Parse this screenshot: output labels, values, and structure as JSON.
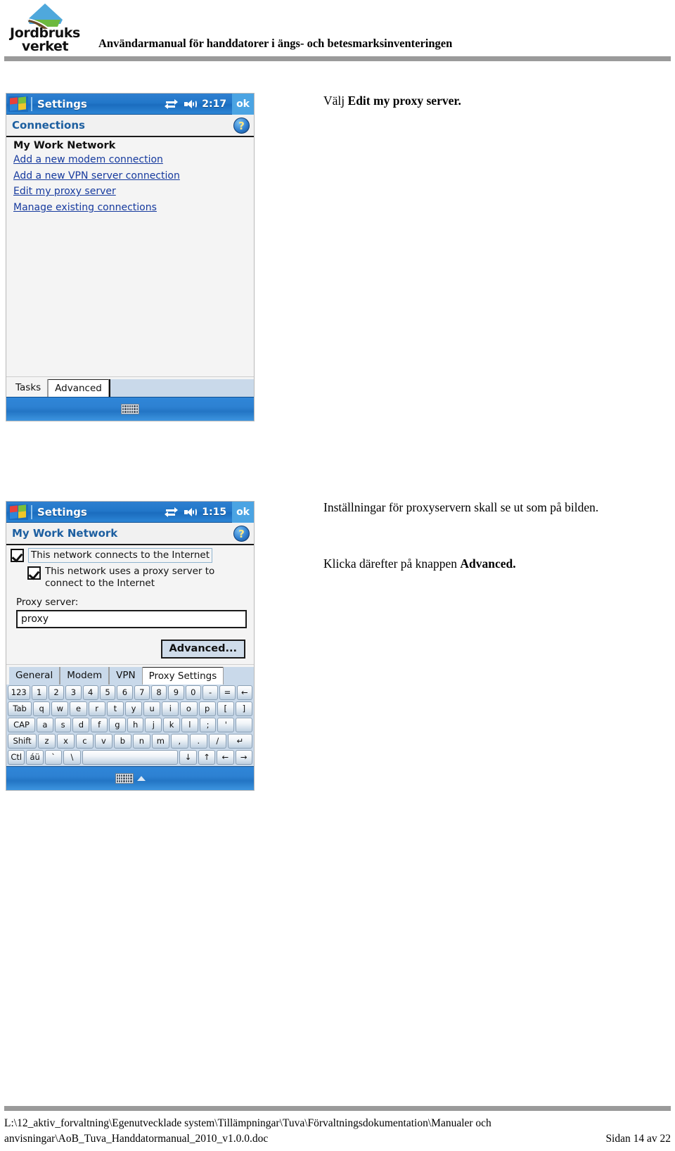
{
  "header": {
    "logo_line1": "Jordbruks",
    "logo_line2": "verket",
    "title": "Användarmanual för handdatorer i ängs- och betesmarksinventeringen"
  },
  "screen1": {
    "titlebar": {
      "app": "Settings",
      "clock": "2:17",
      "ok": "ok",
      "connectivity_icon": "connection-arrows-icon",
      "volume_icon": "speaker-icon",
      "start_icon": "windows-start-icon"
    },
    "page_title": "Connections",
    "help_label": "?",
    "group_title": "My Work Network",
    "links": [
      "Add a new modem connection",
      "Add a new VPN server connection",
      "Edit my proxy server",
      "Manage existing connections"
    ],
    "tabs": [
      {
        "label": "Tasks",
        "selected": false
      },
      {
        "label": "Advanced",
        "selected": true
      }
    ],
    "soft_keyboard_icon": "keyboard-icon"
  },
  "screen2": {
    "titlebar": {
      "app": "Settings",
      "clock": "1:15",
      "ok": "ok",
      "connectivity_icon": "connection-arrows-icon",
      "volume_icon": "speaker-icon",
      "start_icon": "windows-start-icon"
    },
    "page_title": "My Work Network",
    "help_label": "?",
    "checkbox1_label": "This network connects to the Internet",
    "checkbox1_checked": true,
    "checkbox2_label": "This network uses a proxy server to connect to the Internet",
    "checkbox2_checked": true,
    "proxy_field_label": "Proxy server:",
    "proxy_field_value": "proxy",
    "advanced_button": "Advanced...",
    "tabs": [
      {
        "label": "General",
        "selected": false
      },
      {
        "label": "Modem",
        "selected": false
      },
      {
        "label": "VPN",
        "selected": false
      },
      {
        "label": "Proxy Settings",
        "selected": true
      }
    ],
    "soft_keyboard_icon": "keyboard-icon",
    "caret_icon": "caret-up-icon",
    "keyboard_rows": [
      [
        "123",
        "1",
        "2",
        "3",
        "4",
        "5",
        "6",
        "7",
        "8",
        "9",
        "0",
        "-",
        "=",
        "←"
      ],
      [
        "Tab",
        "q",
        "w",
        "e",
        "r",
        "t",
        "y",
        "u",
        "i",
        "o",
        "p",
        "[",
        "]"
      ],
      [
        "CAP",
        "a",
        "s",
        "d",
        "f",
        "g",
        "h",
        "j",
        "k",
        "l",
        ";",
        "'"
      ],
      [
        "Shift",
        "z",
        "x",
        "c",
        "v",
        "b",
        "n",
        "m",
        ",",
        ".",
        "/",
        "↵"
      ],
      [
        "Ctl",
        "áü",
        "`",
        "\\",
        " ",
        "↓",
        "↑",
        "←",
        "→"
      ]
    ]
  },
  "notes": {
    "note1_prefix": "Välj ",
    "note1_bold": "Edit my proxy server.",
    "note2": "Inställningar för proxyservern skall se ut som på bilden.",
    "note3_prefix": "Klicka därefter på knappen ",
    "note3_bold": "Advanced."
  },
  "footer": {
    "path_line1": "L:\\12_aktiv_forvaltning\\Egenutvecklade system\\Tillämpningar\\Tuva\\Förvaltningsdokumentation\\Manualer och",
    "path_line2": "anvisningar\\AoB_Tuva_Handdatormanual_2010_v1.0.0.doc",
    "page_label": "Sidan 14 av 22"
  },
  "colors": {
    "titlebar_blue": "#2277c9",
    "link_blue": "#163a9e",
    "page_title_blue": "#1d5fa0",
    "tab_blue": "#c9d9ea",
    "rule_gray": "#9a9a9a"
  }
}
